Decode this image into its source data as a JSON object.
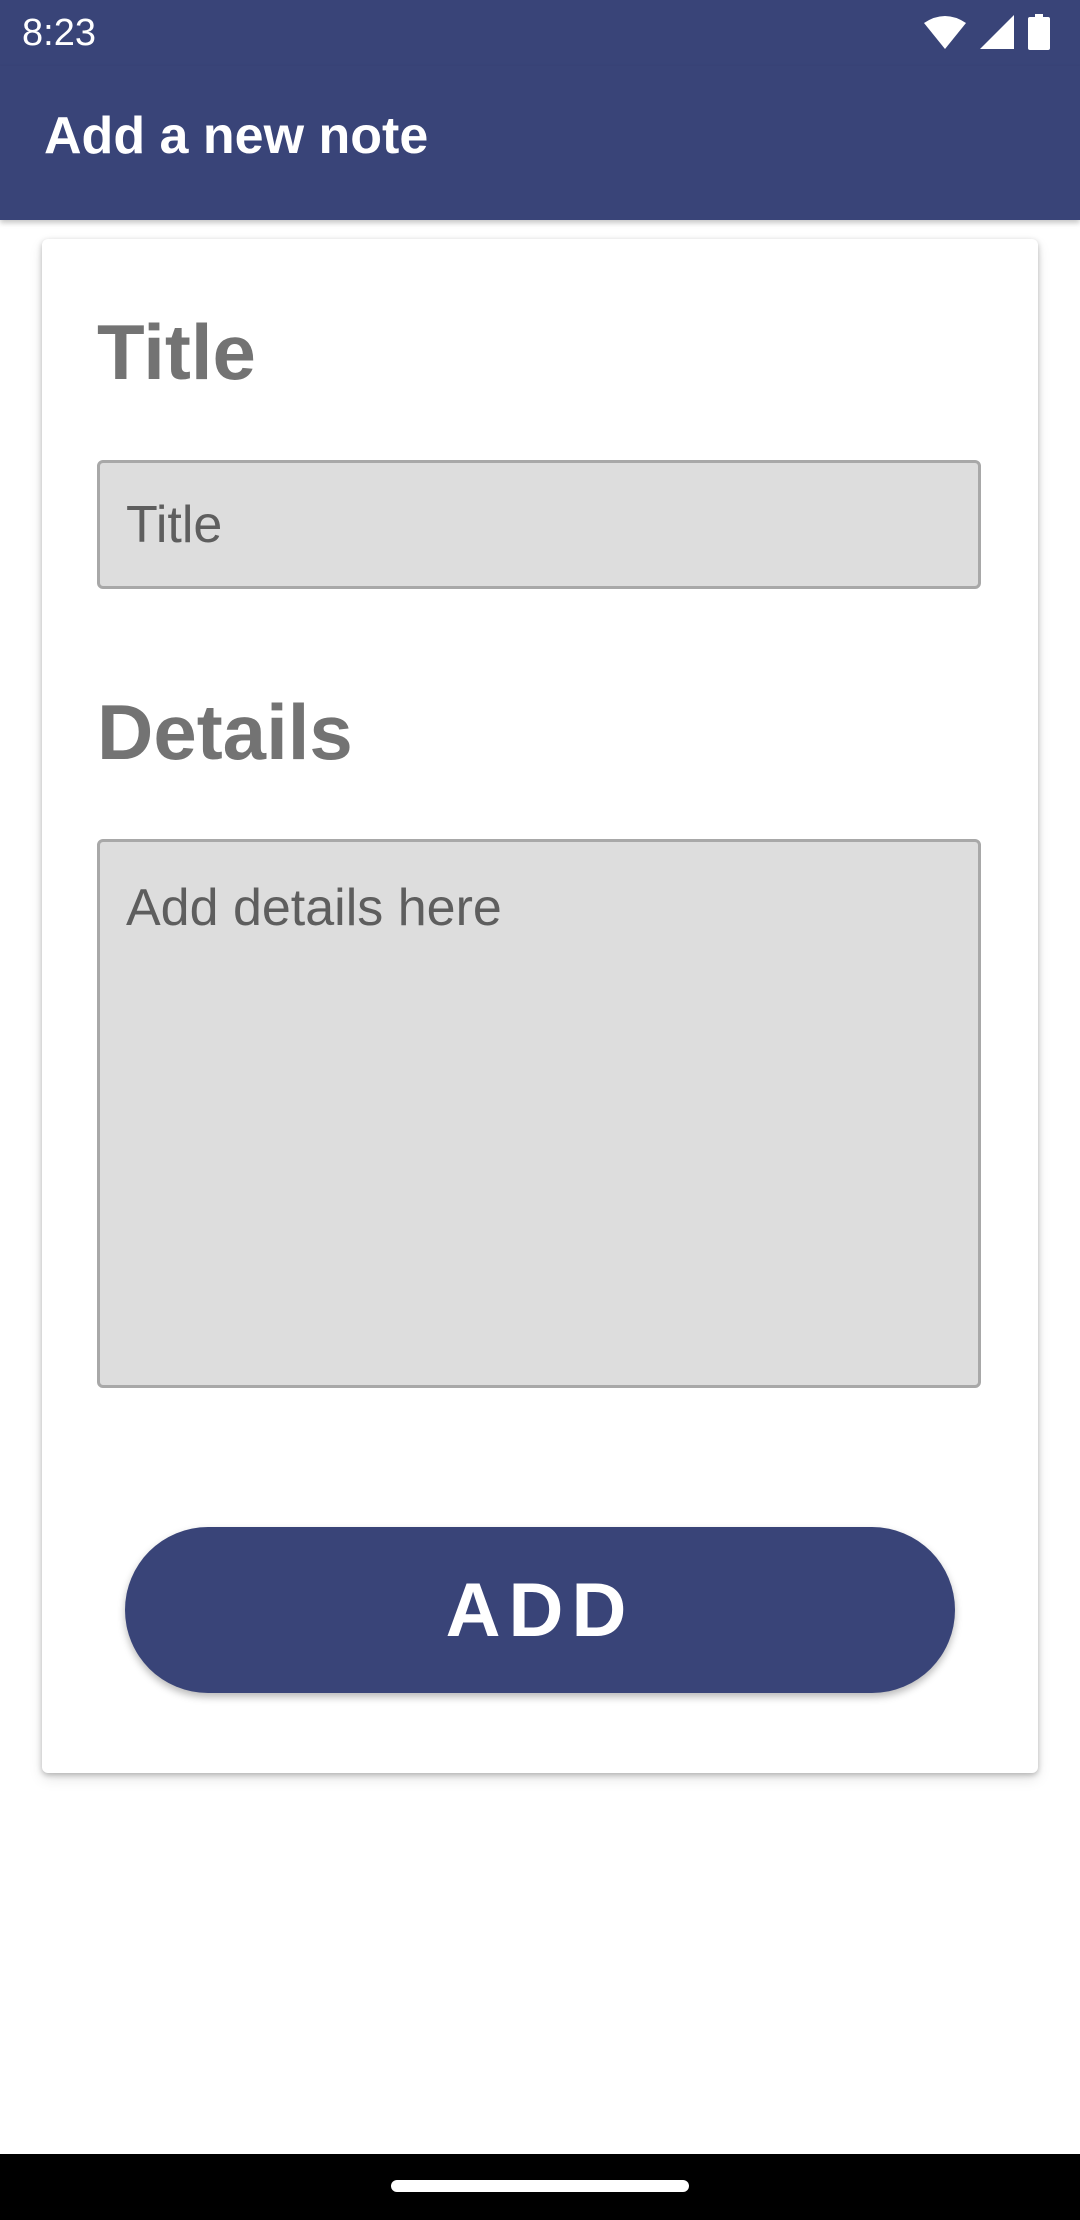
{
  "status_bar": {
    "time": "8:23",
    "icons": [
      "wifi-icon",
      "cellular-signal-icon",
      "battery-icon"
    ]
  },
  "app_bar": {
    "title": "Add a new note"
  },
  "form": {
    "title_heading": "Title",
    "title_placeholder": "Title",
    "title_value": "",
    "details_heading": "Details",
    "details_placeholder": "Add details here",
    "details_value": "",
    "add_button_label": "ADD"
  },
  "colors": {
    "primary": "#394478",
    "heading_text": "#737373",
    "field_background": "#dddddd",
    "field_border": "#a8a8a8",
    "placeholder_text": "#5e5e5e"
  }
}
